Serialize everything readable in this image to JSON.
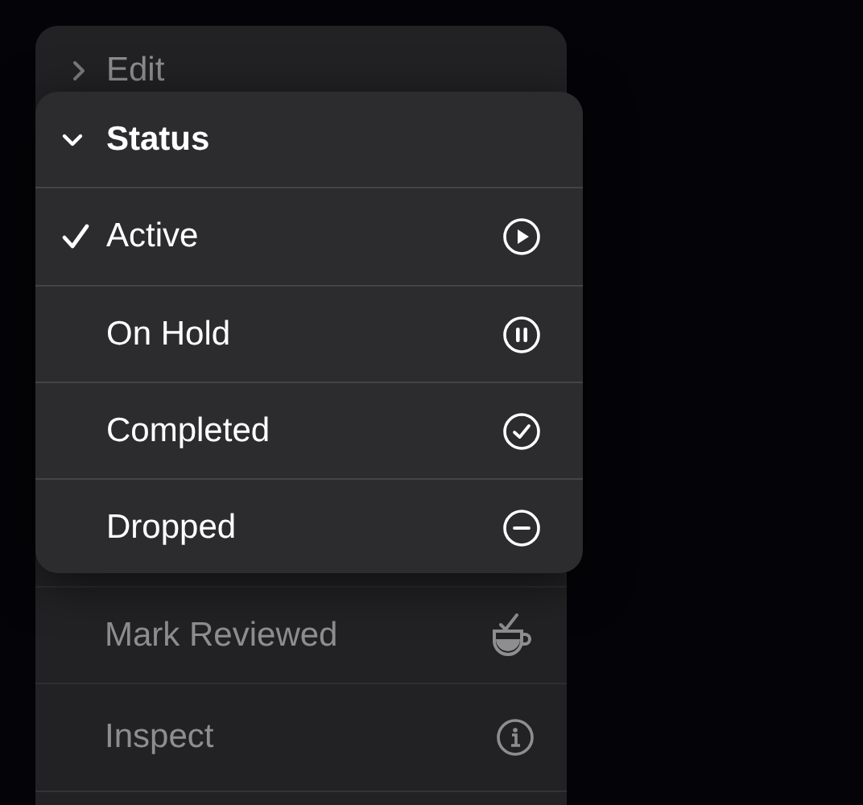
{
  "menu": {
    "items": [
      {
        "kind": "submenu",
        "label": "Edit",
        "expanded": false
      },
      {
        "kind": "action",
        "label": "Mark Reviewed"
      },
      {
        "kind": "action",
        "label": "Inspect"
      }
    ]
  },
  "submenu": {
    "title": "Status",
    "expanded": true,
    "options": [
      {
        "label": "Active",
        "selected": true
      },
      {
        "label": "On Hold",
        "selected": false
      },
      {
        "label": "Completed",
        "selected": false
      },
      {
        "label": "Dropped",
        "selected": false
      }
    ]
  }
}
